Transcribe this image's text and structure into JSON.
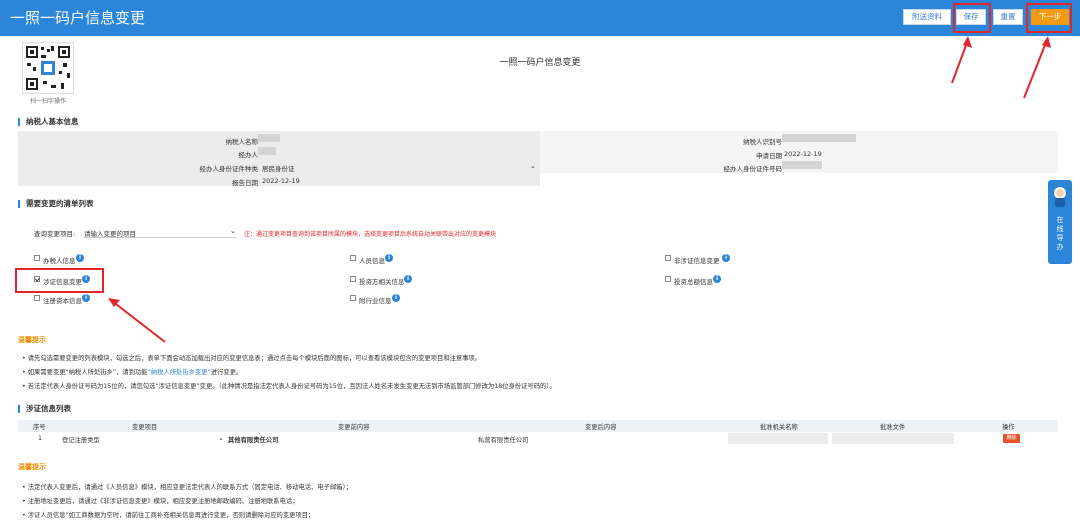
{
  "header": {
    "title": "一照一码户信息变更",
    "buttons": {
      "attach": "附送资料",
      "save": "保存",
      "reset": "重置",
      "next": "下一步"
    }
  },
  "qr": {
    "caption": "扫一扫字操作"
  },
  "page_title": "一照一码户信息变更",
  "basic_info": {
    "section_title": "纳税人基本信息",
    "fields": {
      "name_label": "纳税人名称",
      "id_label": "纳税人识别号",
      "handler_label": "经办人",
      "apply_date_label": "申请日期",
      "apply_date_value": "2022-12-19",
      "id_type_label": "经办人身份证件种类",
      "id_type_value": "居民身份证",
      "id_no_label": "经办人身份证件号码",
      "report_date_label": "报告日期",
      "report_date_value": "2022-12-19"
    }
  },
  "change_list": {
    "section_title": "需要变更的清单列表",
    "query_label": "查询变更项目:",
    "query_placeholder": "请输入变更的项目",
    "note": "注：通过变更项目查询到该项目所属的模块，选择变更项目后系统自动关联带出对应的变更模块",
    "items": {
      "taxpayer_info": "办税人信息",
      "personnel_info": "人员信息",
      "non_cert_change": "非涉证信息变更",
      "cert_change": "涉证信息变更",
      "investor_info": "投资方相关信息",
      "investment_total": "投资总额信息",
      "registered_capital": "注册资本信息",
      "industry_info": "附行业信息"
    }
  },
  "tips1": {
    "title": "温馨提示",
    "lines": [
      "请先勾选需要变更的列表模块，勾选之后，表单下面会动态加载出对应的变更信息表；通过点击每个模块后面的图标，可以查看该模块包含的变更项目和注意事项。",
      "如果需要变更“纳税人所处街乡”，请到功能",
      "“纳税人所处街乡变更”",
      "进行变更。",
      "若法定代表人身份证号码为15位的，请您勾选“涉证信息变更”变更。（此种情况是指法定代表人身份证号码为15位，且因法人姓名未发生变更无法到市场监管部门修改为18位身份证号码的）。"
    ]
  },
  "cert_table": {
    "section_title": "涉证信息列表",
    "columns": [
      "序号",
      "变更项目",
      "变更前内容",
      "变更后内容",
      "批准机关名称",
      "批准文件",
      "操作"
    ],
    "row": {
      "index": "1",
      "item": "登记注册类型",
      "before": "其他有限责任公司",
      "after": "私营有限责任公司",
      "action": "删除"
    }
  },
  "tips2": {
    "title": "温馨提示",
    "lines": [
      "法定代表人变更后，请通过《人员信息》模块，相应变更法定代表人的联系方式（固定电话、移动电话、电子邮箱）；",
      "注册地址变更后，请通过《非涉证信息变更》模块，相应变更注册地邮政编码、注册地联系电话；",
      "涉证人员信息”如工商数据为空时，请前往工商补充相关信息再进行变更，否则请删除对应的变更项目；"
    ]
  },
  "side_widget": {
    "label": "在线导办"
  },
  "colors": {
    "header": "#2b86d9",
    "next_button": "#f39a12",
    "highlight": "#e0262b",
    "tip_title": "#f08c00"
  }
}
